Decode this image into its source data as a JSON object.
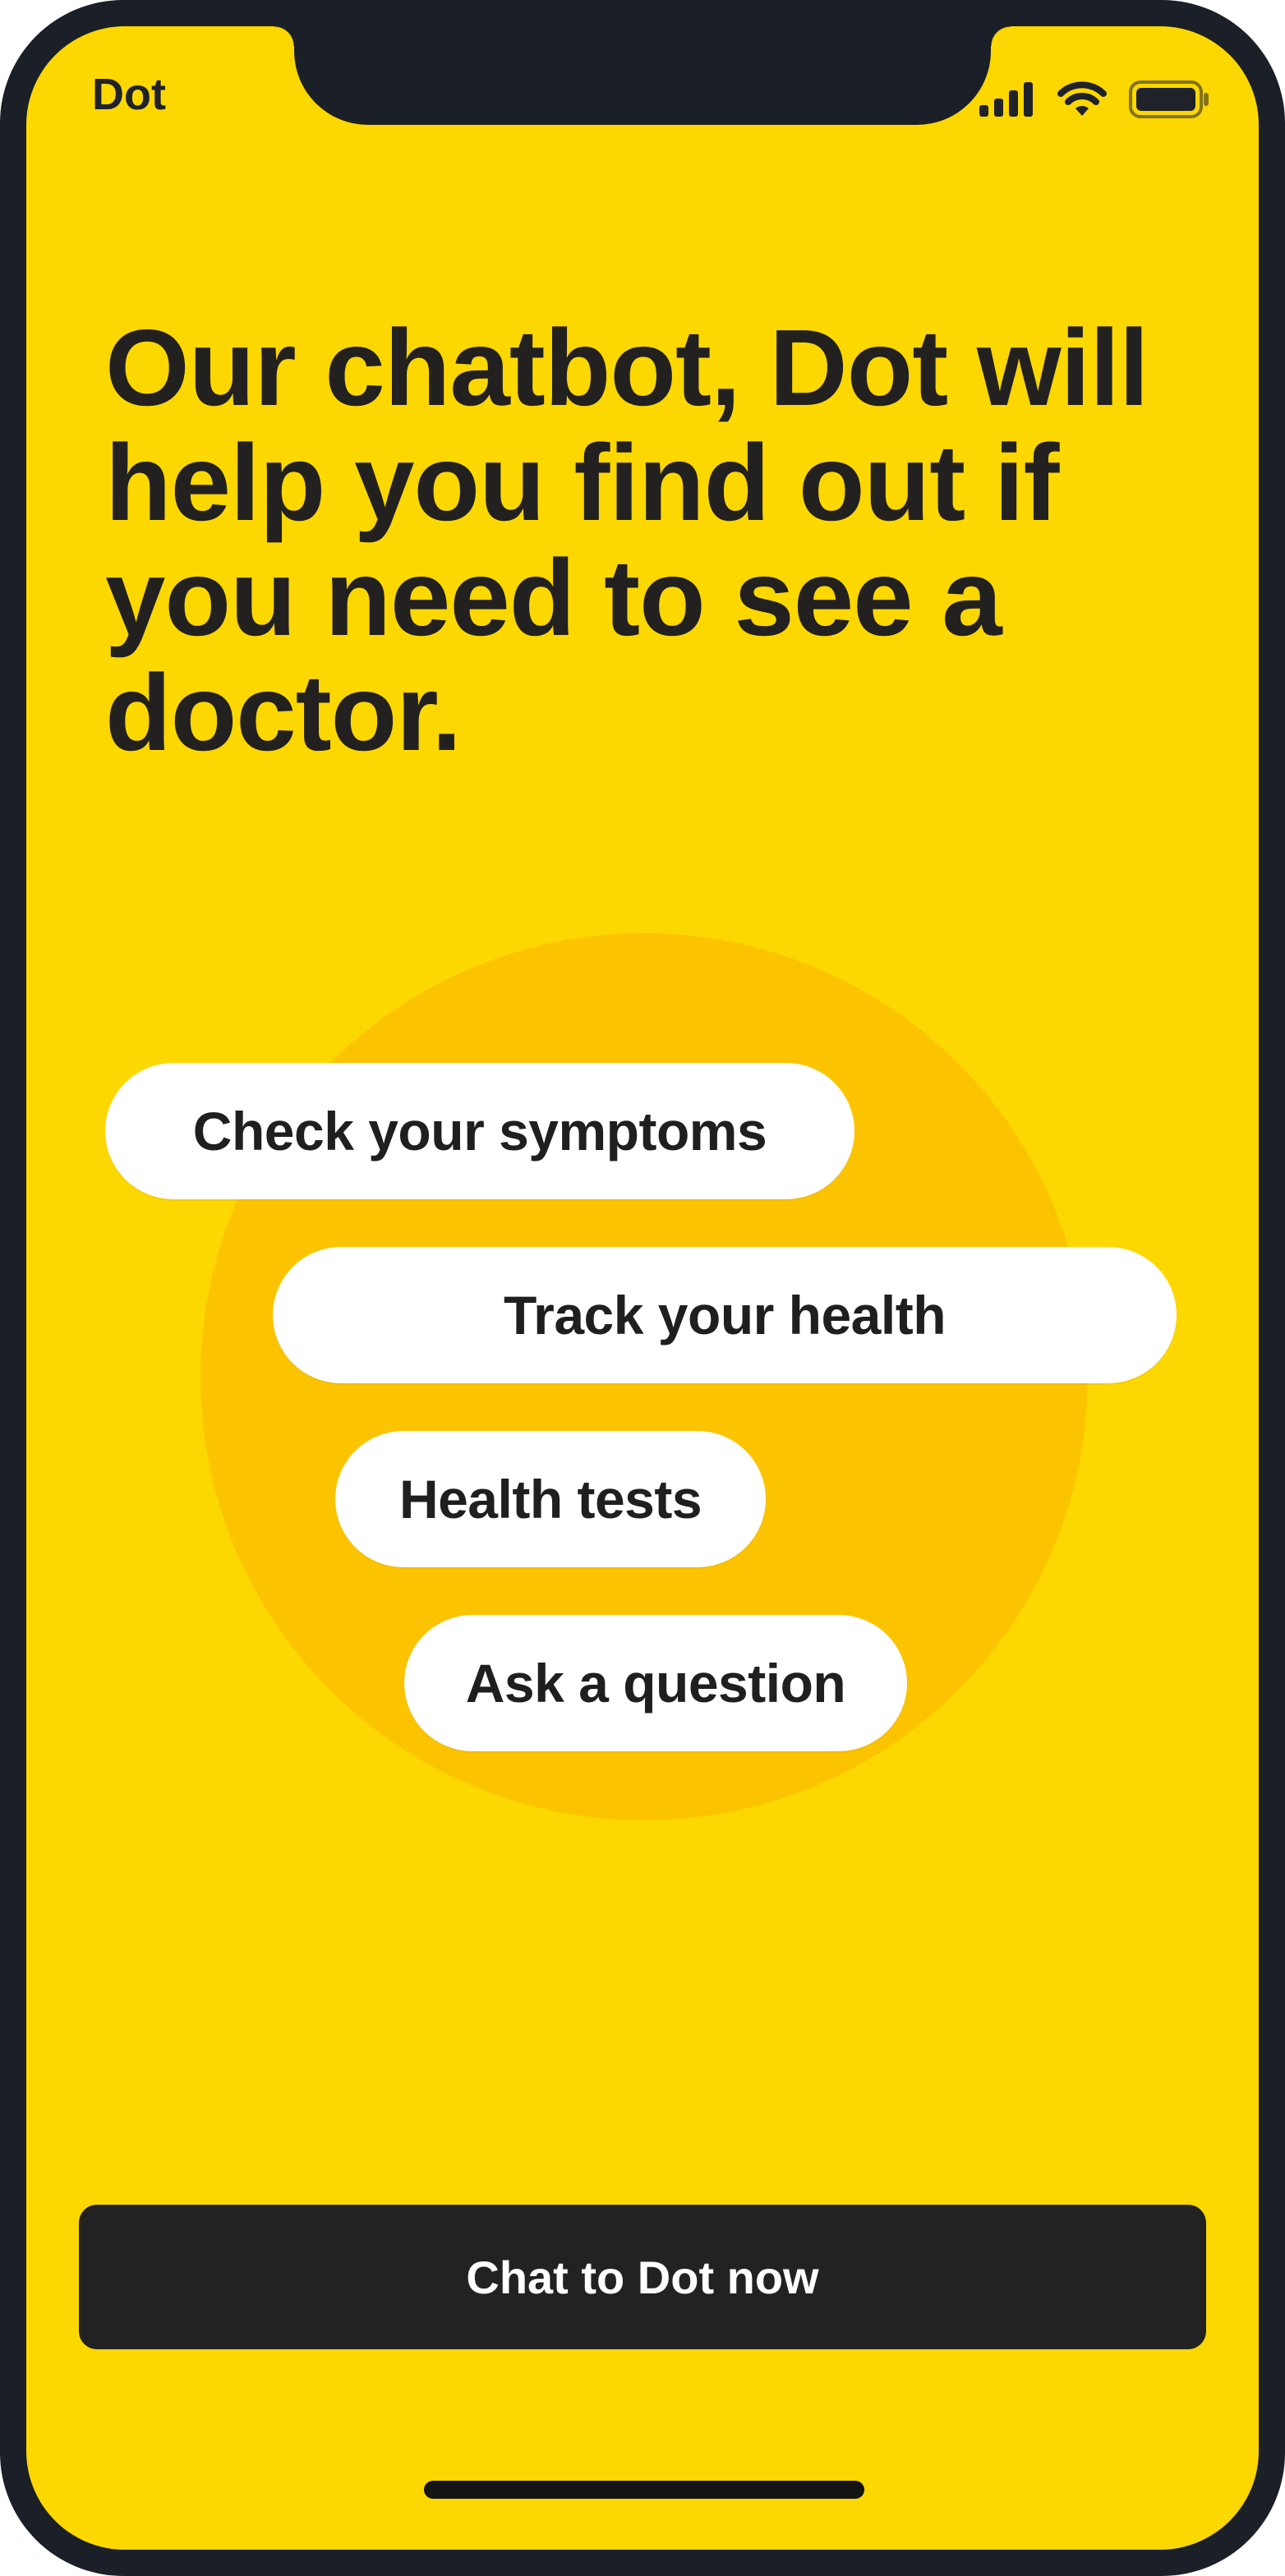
{
  "status_bar": {
    "app_name": "Dot",
    "icons": [
      "cellular-signal-icon",
      "wifi-icon",
      "battery-icon"
    ]
  },
  "headline": "Our chatbot, Dot will help you find out if you need to see a doctor.",
  "options": [
    {
      "label": "Check your symptoms"
    },
    {
      "label": "Track your health"
    },
    {
      "label": "Health tests"
    },
    {
      "label": "Ask a question"
    }
  ],
  "cta": {
    "label": "Chat to Dot now"
  },
  "colors": {
    "background": "#fdd700",
    "circle": "#fcc400",
    "pill": "#ffffff",
    "cta": "#222222",
    "frame": "#1b1f27"
  }
}
